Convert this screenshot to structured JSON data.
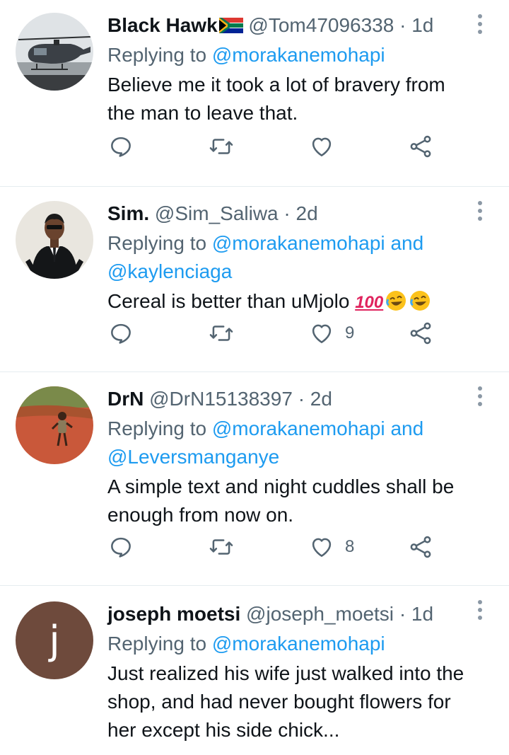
{
  "tweets": [
    {
      "name": "Black Hawk",
      "handle": "@Tom47096338",
      "time": "1d",
      "replying_label": "Replying to",
      "mentions": [
        "@moraka nemohapi"
      ],
      "mention_1": "@morakanemohapi",
      "mention_2": "",
      "text": "Believe me it took a lot of bravery from the man to leave that.",
      "likes": ""
    },
    {
      "name": "Sim.",
      "handle": "@Sim_Saliwa",
      "time": "2d",
      "replying_label": "Replying to",
      "mention_1": "@morakanemohapi",
      "and": "and",
      "mention_2": "@kaylenciaga",
      "text": "Cereal is better than uMjolo",
      "emoji_hundred": "100",
      "likes": "9"
    },
    {
      "name": "DrN",
      "handle": "@DrN15138397",
      "time": "2d",
      "replying_label": "Replying to",
      "mention_1": "@morakanemohapi",
      "and": "and",
      "mention_2": "@Leversmanganye",
      "text": "A simple text and night cuddles shall be enough from now on.",
      "likes": "8"
    },
    {
      "name": "joseph moetsi",
      "handle": "@joseph_moetsi",
      "time": "1d",
      "replying_label": "Replying to",
      "mention_1": "@morakanemohapi",
      "mention_2": "",
      "text": "Just  realized his wife just walked into the shop, and had never bought flowers for her except his side chick...",
      "avatar_letter": "j",
      "likes": ""
    }
  ],
  "separator": "·",
  "icons": {
    "reply": "reply-icon",
    "retweet": "retweet-icon",
    "like": "heart-icon",
    "share": "share-icon",
    "more": "more-vertical-icon"
  },
  "colors": {
    "link": "#1d9bf0",
    "secondary_text": "#536471",
    "avatar_j": "#6e4a3c"
  }
}
